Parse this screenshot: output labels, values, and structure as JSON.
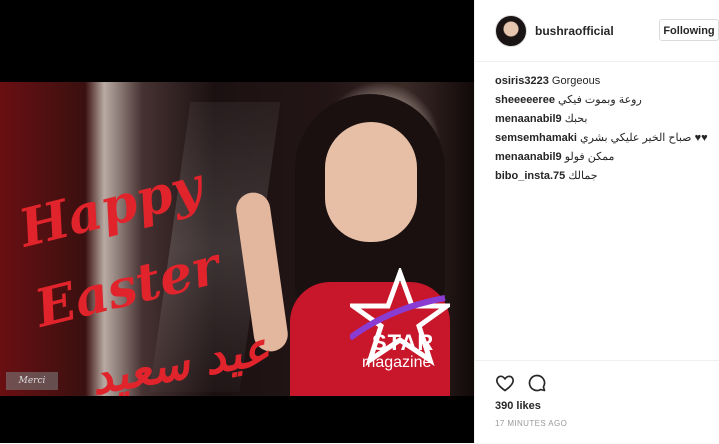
{
  "post": {
    "image_text": {
      "happy": "Happy",
      "easter": "Easter",
      "arabic_greeting": "عيد سعيد",
      "star": "STAR",
      "magazine": "magazine",
      "watermark": "Merci"
    },
    "header": {
      "username": "bushraofficial",
      "follow_label": "Following"
    },
    "comments": [
      {
        "user": "osiris3223",
        "text": "Gorgeous"
      },
      {
        "user": "sheeeeeree",
        "text": "روعة وبموت فيكي"
      },
      {
        "user": "menaanabil9",
        "text": "بحبك"
      },
      {
        "user": "semsemhamaki",
        "text": "صباح الخير عليكي بشري ♥♥"
      },
      {
        "user": "menaanabil9",
        "text": "ممكن فولو"
      },
      {
        "user": "bibo_insta.75",
        "text": "جمالك"
      }
    ],
    "actions": {
      "heart_icon": "heart-icon",
      "comment_icon": "comment-icon"
    },
    "likes": "390 likes",
    "timestamp": "17 MINUTES AGO"
  }
}
